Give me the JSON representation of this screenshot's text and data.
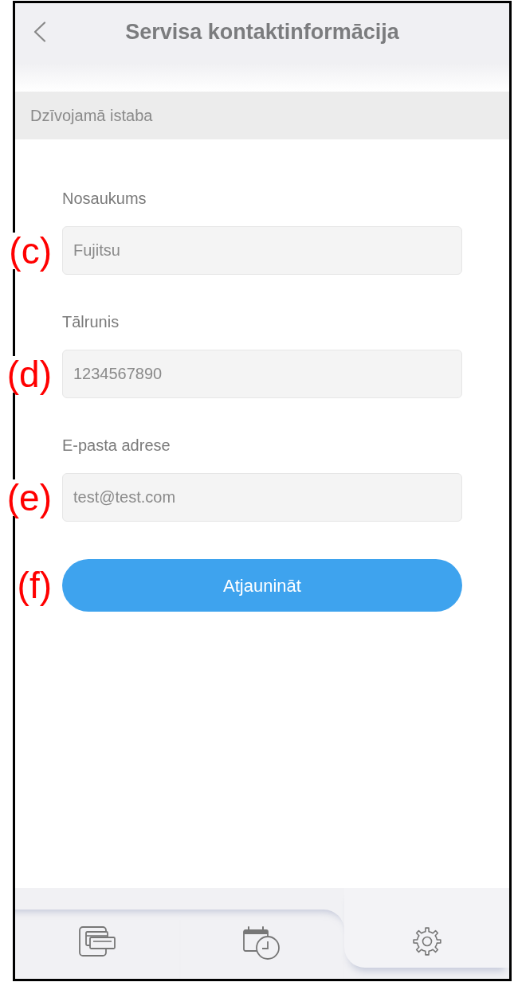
{
  "header": {
    "title": "Servisa kontaktinformācija"
  },
  "section": {
    "title": "Dzīvojamā istaba"
  },
  "fields": [
    {
      "label": "Nosaukums",
      "value": "Fujitsu",
      "callout": "(c)"
    },
    {
      "label": "Tālrunis",
      "value": "1234567890",
      "callout": "(d)"
    },
    {
      "label": "E-pasta adrese",
      "value": "test@test.com",
      "callout": "(e)"
    }
  ],
  "button": {
    "label": "Atjaunināt",
    "callout": "(f)"
  },
  "bottom_nav": [
    {
      "kind": "devices",
      "selected": false
    },
    {
      "kind": "schedule",
      "selected": false
    },
    {
      "kind": "settings",
      "selected": true
    }
  ]
}
